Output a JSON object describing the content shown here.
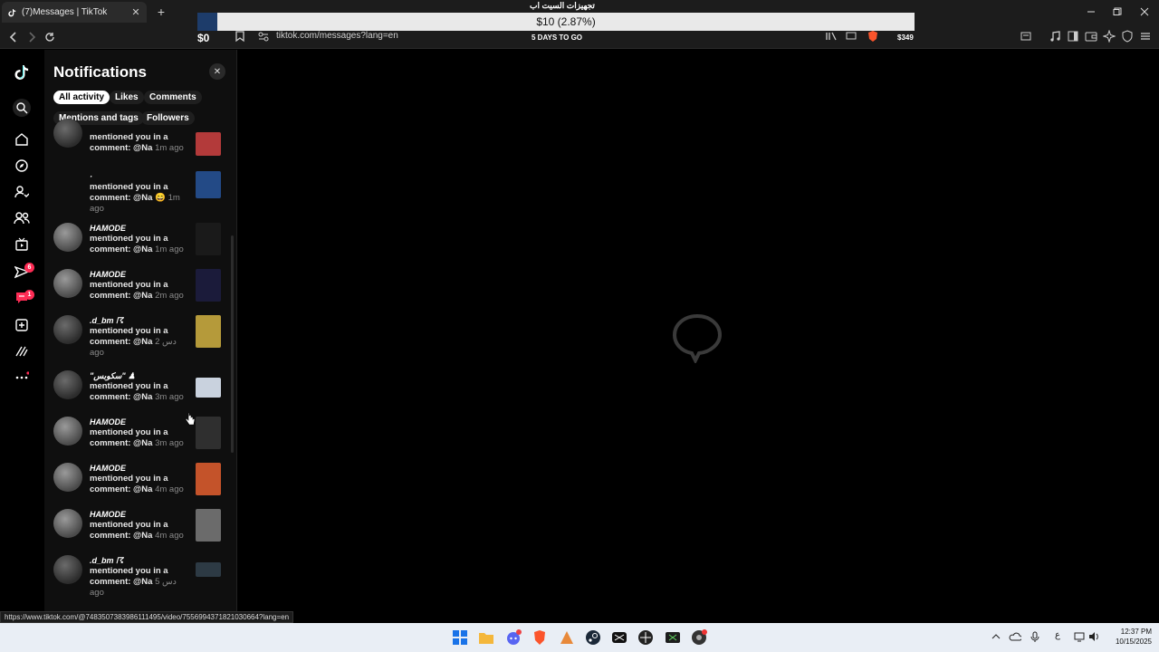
{
  "browser": {
    "tab_title": "(7)Messages | TikTok",
    "tab_close": "✕",
    "new_tab": "+",
    "url": "tiktok.com/messages?lang=en",
    "status_url": "https://www.tiktok.com/@7483507383986111495/video/7556994371821030664?lang=en"
  },
  "banner": {
    "title": "تجهيزات السيت اب",
    "amount": "$10 (2.87%)",
    "money_left": "$0",
    "days": "5 DAYS TO GO",
    "money_right": "$349"
  },
  "rail": {
    "inbox_badge": "6",
    "messages_badge": "1"
  },
  "notifications": {
    "title": "Notifications",
    "close": "✕",
    "filters": [
      "All activity",
      "Likes",
      "Comments",
      "Mentions and tags",
      "Followers"
    ],
    "items": [
      {
        "user": "",
        "line1": "mentioned you in a",
        "line2": "comment: @Na",
        "time": "1m ago",
        "thumb": "#b33a3a"
      },
      {
        "user": "·",
        "line1": "mentioned you in a",
        "line2": "comment: @Na 😄",
        "time": "1m ago",
        "thumb": "#234a86"
      },
      {
        "user": "HAMODE",
        "line1": "mentioned you in a",
        "line2": "comment: @Na",
        "time": "1m ago",
        "thumb": "#1a1a1a"
      },
      {
        "user": "HAMODE",
        "line1": "mentioned you in a",
        "line2": "comment: @Na",
        "time": "2m ago",
        "thumb": "#1b1b3a"
      },
      {
        "user": ".d_bm ☈",
        "line1": "mentioned you in a",
        "line2": "comment: @Na",
        "time": "2 دس ago",
        "thumb": "#b59a3a"
      },
      {
        "user": "\"سكوبس\" ♟",
        "line1": "mentioned you in a",
        "line2": "comment: @Na",
        "time": "3m ago",
        "thumb": "#c9d2de"
      },
      {
        "user": "HAMODE",
        "line1": "mentioned you in a",
        "line2": "comment: @Na",
        "time": "3m ago",
        "thumb": "#2f2f2f"
      },
      {
        "user": "HAMODE",
        "line1": "mentioned you in a",
        "line2": "comment: @Na",
        "time": "4m ago",
        "thumb": "#c4532a"
      },
      {
        "user": "HAMODE",
        "line1": "mentioned you in a",
        "line2": "comment: @Na",
        "time": "4m ago",
        "thumb": "#6b6b6b"
      },
      {
        "user": ".d_bm ☈",
        "line1": "mentioned you in a",
        "line2": "comment: @Na",
        "time": "5 دس ago",
        "thumb": "#2d3a44"
      }
    ]
  },
  "taskbar": {
    "lang": "ع",
    "time": "12:37 PM",
    "date": "10/15/2025"
  },
  "colors": {
    "accent": "#fe2c55",
    "panel_bg": "#0f0f0f",
    "taskbar_bg": "#e9eef5"
  }
}
